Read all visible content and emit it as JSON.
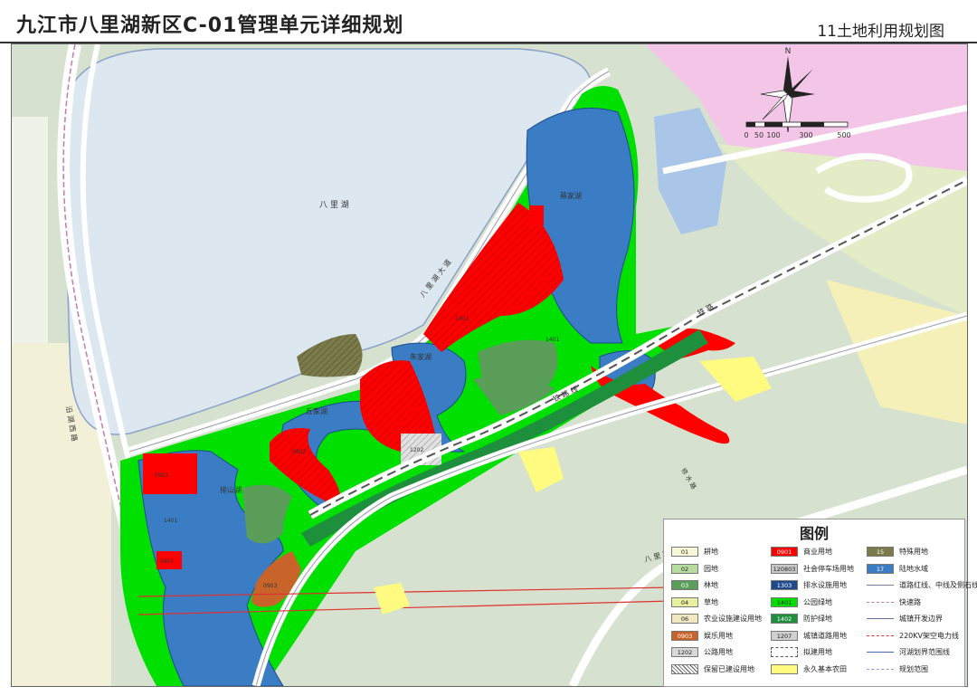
{
  "header": {
    "title": "九江市八里湖新区C-01管理单元详细规划",
    "subtitle": "11土地利用规划图"
  },
  "map": {
    "place_labels": [
      "八 里 湖",
      "蔡家湖",
      "朱家湖",
      "丘家湖",
      "排山湖"
    ],
    "road_labels": [
      "八 里 湖 大 道",
      "铁 路 线",
      "铁 路",
      "八 里 路",
      "沿 湖 西 路",
      "修 水 路"
    ],
    "parcel_codes": [
      "0901",
      "0901",
      "1401",
      "1401",
      "1202",
      "0902",
      "1401",
      "0903"
    ],
    "scale_bar": {
      "labels": [
        "0",
        "50",
        "100",
        "300",
        "500"
      ]
    },
    "colors": {
      "lake": "#dde7f0",
      "water": "#3b7dc4",
      "commercial": "#ff0000",
      "park": "#00e000",
      "protective_green": "#1e8f3c",
      "forest": "#5a9e5a",
      "garden": "#b8dca0",
      "entertainment": "#c8642a",
      "special": "#7a7a4a",
      "parking": "#c8c8c8",
      "farmland_protected": "#fffa80",
      "terrain": "#c9d8c0",
      "residential_pink": "#f3c6e8",
      "road": "#ffffff",
      "road_edge": "#9a9aa8"
    }
  },
  "legend": {
    "title": "图例",
    "items": [
      {
        "code": "01",
        "label": "耕地",
        "color": "#f8f8d8",
        "type": "swatch"
      },
      {
        "code": "02",
        "label": "园地",
        "color": "#b8dca0",
        "type": "swatch"
      },
      {
        "code": "03",
        "label": "林地",
        "color": "#5a9e5a",
        "type": "swatch"
      },
      {
        "code": "04",
        "label": "草地",
        "color": "#e8f0a0",
        "type": "swatch"
      },
      {
        "code": "06",
        "label": "农业设施建设用地",
        "color": "#f0e8c0",
        "type": "swatch"
      },
      {
        "code": "0903",
        "label": "娱乐用地",
        "color": "#c8642a",
        "type": "swatch"
      },
      {
        "code": "1202",
        "label": "公路用地",
        "color": "#d8d8d8",
        "type": "swatch"
      },
      {
        "code": "",
        "label": "保留已建设用地",
        "color": "#ffffff",
        "type": "hatch"
      },
      {
        "code": "0901",
        "label": "商业用地",
        "color": "#ff0000",
        "type": "swatch"
      },
      {
        "code": "120803",
        "label": "社会停车场用地",
        "color": "#c8c8c8",
        "type": "swatch"
      },
      {
        "code": "1303",
        "label": "排水设施用地",
        "color": "#1e4a8c",
        "type": "swatch"
      },
      {
        "code": "1401",
        "label": "公园绿地",
        "color": "#00e000",
        "type": "swatch"
      },
      {
        "code": "1402",
        "label": "防护绿地",
        "color": "#1e8f3c",
        "type": "swatch"
      },
      {
        "code": "1207",
        "label": "城镇道路用地",
        "color": "#d0d0d0",
        "type": "swatch"
      },
      {
        "code": "",
        "label": "拟建用地",
        "color": "#ffffff",
        "type": "dashbox"
      },
      {
        "code": "",
        "label": "永久基本农田",
        "color": "#fffa80",
        "type": "swatch"
      },
      {
        "code": "15",
        "label": "特殊用地",
        "color": "#7a7a4a",
        "type": "swatch"
      },
      {
        "code": "17",
        "label": "陆地水域",
        "color": "#3b7dc4",
        "type": "swatch"
      },
      {
        "code": "",
        "label": "道路红线、中线及侧石线",
        "color": "#7a7aa0",
        "type": "line"
      },
      {
        "code": "",
        "label": "快速路",
        "color": "#c07ab0",
        "type": "line"
      },
      {
        "code": "",
        "label": "城镇开发边界",
        "color": "#6a6a9a",
        "type": "line"
      },
      {
        "code": "",
        "label": "220KV架空电力线",
        "color": "#e03030",
        "type": "line"
      },
      {
        "code": "",
        "label": "河湖划界范围线",
        "color": "#4a6ab0",
        "type": "line"
      },
      {
        "code": "",
        "label": "规划范围",
        "color": "#8aa0c8",
        "type": "line"
      }
    ]
  }
}
